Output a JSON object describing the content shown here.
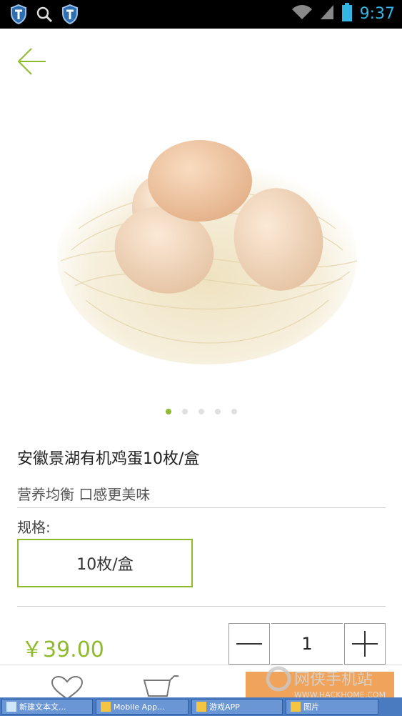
{
  "status_bar": {
    "time": "9:37",
    "left_icons": [
      "shield-icon",
      "search-icon",
      "shield-icon"
    ],
    "right_icons": [
      "wifi-icon",
      "signal-icon",
      "battery-icon"
    ]
  },
  "header": {
    "back_icon": "back-arrow-icon"
  },
  "gallery": {
    "page_count": 5,
    "active_index": 0
  },
  "product": {
    "title": "安徽景湖有机鸡蛋10枚/盒",
    "subtitle": "营养均衡 口感更美味",
    "spec_label": "规格:",
    "spec_options": [
      "10枚/盒"
    ],
    "price": "￥39.00",
    "quantity": "1"
  },
  "bottom_bar": {
    "favorite_icon": "heart-icon",
    "cart_icon": "cart-icon",
    "watermark_text": "网侠手机站",
    "watermark_sub": "WWW.HACKHOME.COM"
  },
  "taskbar": {
    "items": [
      {
        "label": "新建文本文..."
      },
      {
        "label": "Mobile App..."
      },
      {
        "label": "游戏APP"
      },
      {
        "label": "图片"
      }
    ]
  },
  "colors": {
    "accent": "#8dbb2b",
    "price": "#8dbb2b",
    "add_to_cart": "#f0a35a",
    "clock": "#33b5e5"
  }
}
